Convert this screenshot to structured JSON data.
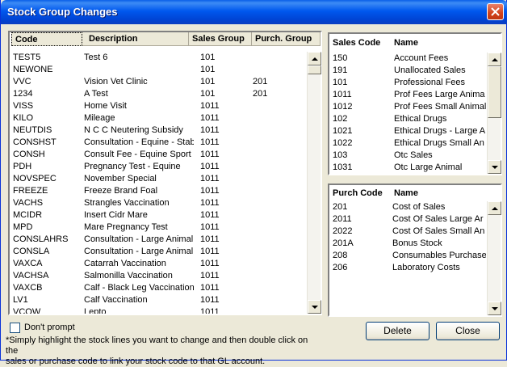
{
  "window": {
    "title": "Stock Group Changes"
  },
  "stock_list": {
    "headers": {
      "code": "Code",
      "description": "Description",
      "sales_group": "Sales Group",
      "purch_group": "Purch. Group"
    },
    "rows": [
      {
        "code": "TEST5",
        "description": "Test 6",
        "sales": "101",
        "purch": ""
      },
      {
        "code": "NEWONE",
        "description": "",
        "sales": "101",
        "purch": ""
      },
      {
        "code": "VVC",
        "description": "Vision Vet Clinic",
        "sales": "101",
        "purch": "201"
      },
      {
        "code": "1234",
        "description": "A Test",
        "sales": "101",
        "purch": "201"
      },
      {
        "code": "VISS",
        "description": "Home Visit",
        "sales": "1011",
        "purch": ""
      },
      {
        "code": "KILO",
        "description": "Mileage",
        "sales": "1011",
        "purch": ""
      },
      {
        "code": "NEUTDIS",
        "description": "N C C Neutering Subsidy",
        "sales": "1011",
        "purch": ""
      },
      {
        "code": "CONSHST",
        "description": "Consultation - Equine - Stabl",
        "sales": "1011",
        "purch": ""
      },
      {
        "code": "CONSH",
        "description": "Consult Fee - Equine Sport",
        "sales": "1011",
        "purch": ""
      },
      {
        "code": "PDH",
        "description": "Pregnancy Test - Equine",
        "sales": "1011",
        "purch": ""
      },
      {
        "code": "NOVSPEC",
        "description": "November Special",
        "sales": "1011",
        "purch": ""
      },
      {
        "code": "FREEZE",
        "description": "Freeze Brand Foal",
        "sales": "1011",
        "purch": ""
      },
      {
        "code": "VACHS",
        "description": "Strangles Vaccination",
        "sales": "1011",
        "purch": ""
      },
      {
        "code": "MCIDR",
        "description": "Insert Cidr Mare",
        "sales": "1011",
        "purch": ""
      },
      {
        "code": "MPD",
        "description": "Mare Pregnancy Test",
        "sales": "1011",
        "purch": ""
      },
      {
        "code": "CONSLAHRS",
        "description": "Consultation - Large Animal /",
        "sales": "1011",
        "purch": ""
      },
      {
        "code": "CONSLA",
        "description": "Consultation - Large Animal",
        "sales": "1011",
        "purch": ""
      },
      {
        "code": "VAXCA",
        "description": "Catarrah Vaccination",
        "sales": "1011",
        "purch": ""
      },
      {
        "code": "VACHSA",
        "description": "Salmonilla Vaccination",
        "sales": "1011",
        "purch": ""
      },
      {
        "code": "VAXCB",
        "description": "Calf - Black Leg Vaccination",
        "sales": "1011",
        "purch": ""
      },
      {
        "code": "LV1",
        "description": "Calf Vaccination",
        "sales": "1011",
        "purch": ""
      },
      {
        "code": "VCOW",
        "description": "Lepto",
        "sales": "1011",
        "purch": ""
      }
    ]
  },
  "sales_list": {
    "headers": {
      "code": "Sales Code",
      "name": "Name"
    },
    "rows": [
      {
        "code": "150",
        "name": "Account Fees"
      },
      {
        "code": "191",
        "name": "Unallocated Sales"
      },
      {
        "code": "101",
        "name": "Professional Fees"
      },
      {
        "code": "1011",
        "name": "Prof Fees Large Anima"
      },
      {
        "code": "1012",
        "name": "Prof Fees Small Animal"
      },
      {
        "code": "102",
        "name": "Ethical Drugs"
      },
      {
        "code": "1021",
        "name": "Ethical Drugs - Large A"
      },
      {
        "code": "1022",
        "name": "Ethical Drugs Small An"
      },
      {
        "code": "103",
        "name": "Otc Sales"
      },
      {
        "code": "1031",
        "name": "Otc Large Animal"
      }
    ]
  },
  "purch_list": {
    "headers": {
      "code": "Purch Code",
      "name": "Name"
    },
    "rows": [
      {
        "code": "201",
        "name": "Cost of Sales"
      },
      {
        "code": "2011",
        "name": "Cost Of Sales Large Ar"
      },
      {
        "code": "2022",
        "name": "Cost Of Sales Small An"
      },
      {
        "code": "201A",
        "name": "Bonus Stock"
      },
      {
        "code": "208",
        "name": "Consumables Purchase"
      },
      {
        "code": "206",
        "name": "Laboratory Costs"
      }
    ]
  },
  "options": {
    "dont_prompt_label": "Don't prompt",
    "dont_prompt_checked": false
  },
  "instructions": {
    "line1": "*Simply highlight the stock lines you want to change and then double click on the",
    "line2": "sales or purchase code to link your stock code to that GL account."
  },
  "buttons": {
    "delete": "Delete",
    "close": "Close"
  },
  "colors": {
    "title_bar": "#0058ee",
    "window_bg": "#ece9d8"
  }
}
